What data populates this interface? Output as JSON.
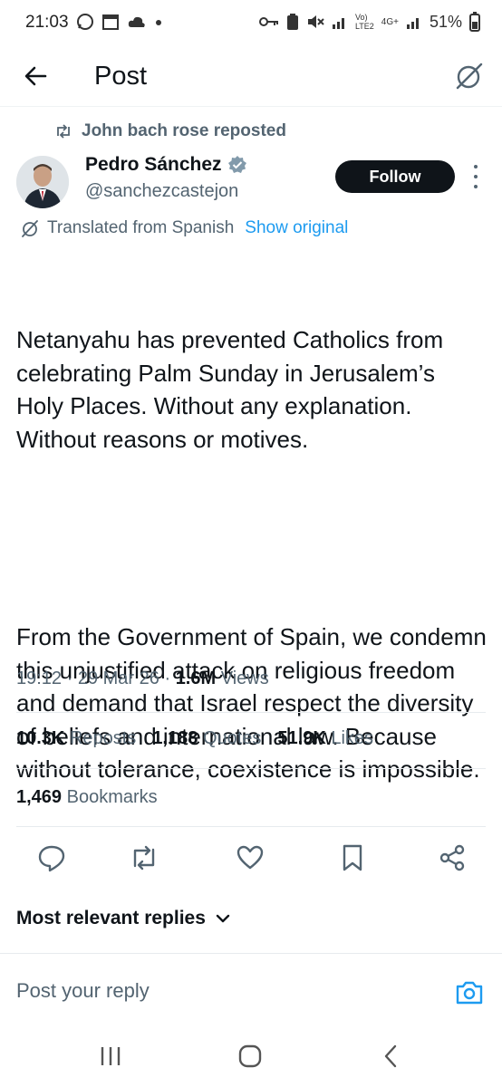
{
  "status_bar": {
    "time": "21:03",
    "network_label_top": "Vo)",
    "network_label_bottom": "LTE2",
    "net_type": "4G+",
    "battery": "51%"
  },
  "header": {
    "title": "Post"
  },
  "repost": {
    "text": "John bach rose reposted"
  },
  "author": {
    "name": "Pedro Sánchez",
    "handle": "@sanchezcastejon",
    "verified_color": "#829aab"
  },
  "follow_button": {
    "label": "Follow"
  },
  "translation": {
    "label": "Translated from Spanish",
    "show_original": "Show original"
  },
  "post": {
    "paragraph1": "Netanyahu has prevented Catholics from celebrating Palm Sunday in Jerusalem’s Holy Places. Without any explanation. Without reasons or motives.",
    "paragraph2": "From the Government of Spain, we condemn this unjustified attack on religious freedom and demand that Israel respect the diversity of beliefs and international law. Because without tolerance, coexistence is impossible."
  },
  "meta": {
    "time": "19:12",
    "date": "29 Mar 26",
    "views_count": "1.6M",
    "views_label": "Views"
  },
  "stats": {
    "reposts_count": "10.3K",
    "reposts_label": "Reposts",
    "quotes_count": "1,188",
    "quotes_label": "Quotes",
    "likes_count": "51.9K",
    "likes_label": "Likes",
    "bookmarks_count": "1,469",
    "bookmarks_label": "Bookmarks"
  },
  "actions": [
    "reply-icon",
    "repost-icon",
    "like-icon",
    "bookmark-icon",
    "share-icon"
  ],
  "replies": {
    "sort_label": "Most relevant replies"
  },
  "reply_bar": {
    "placeholder": "Post your reply"
  },
  "colors": {
    "accent": "#1d9bf0",
    "text_primary": "#0f1419",
    "text_secondary": "#536471"
  }
}
